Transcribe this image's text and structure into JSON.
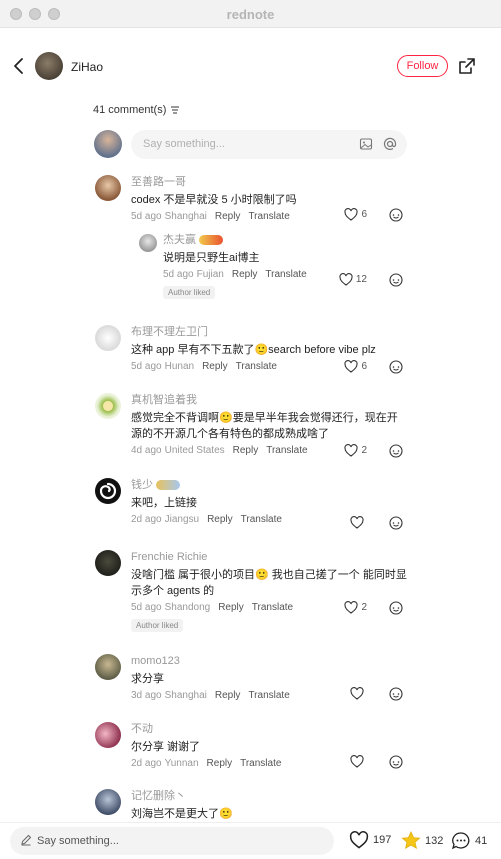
{
  "window": {
    "title": "rednote"
  },
  "header": {
    "author_name": "ZiHao",
    "follow_label": "Follow"
  },
  "comments_header": {
    "count_label": "41 comment(s)",
    "input_placeholder": "Say something..."
  },
  "comments": [
    {
      "name": "至善路一哥",
      "text": "codex 不是早就没 5 小时限制了吗",
      "time": "5d ago",
      "location": "Shanghai",
      "reply": "Reply",
      "translate": "Translate",
      "likes": "6"
    },
    {
      "name": "杰夫赢",
      "text": "说明是只野生ai博主",
      "time": "5d ago",
      "location": "Fujian",
      "reply": "Reply",
      "translate": "Translate",
      "likes": "12",
      "tag": "Author liked"
    },
    {
      "name": "布理不理左卫门",
      "text": "这种 app 早有不下五款了🙂search before vibe plz",
      "time": "5d ago",
      "location": "Hunan",
      "reply": "Reply",
      "translate": "Translate",
      "likes": "6"
    },
    {
      "name": "真机智追着我",
      "text": "感觉完全不背调啊🙂要是早半年我会觉得还行，现在开源的不开源几个各有特色的都成熟成啥了",
      "time": "4d ago",
      "location": "United States",
      "reply": "Reply",
      "translate": "Translate",
      "likes": "2"
    },
    {
      "name": "钱少",
      "text": "来吧，上链接",
      "time": "2d ago",
      "location": "Jiangsu",
      "reply": "Reply",
      "translate": "Translate",
      "likes": ""
    },
    {
      "name": "Frenchie Richie",
      "text": "没啥门槛 属于很小的项目🙂 我也自己搓了一个 能同时显示多个 agents 的",
      "time": "5d ago",
      "location": "Shandong",
      "reply": "Reply",
      "translate": "Translate",
      "likes": "2",
      "tag": "Author liked"
    },
    {
      "name": "momo123",
      "text": "求分享",
      "time": "3d ago",
      "location": "Shanghai",
      "reply": "Reply",
      "translate": "Translate",
      "likes": ""
    },
    {
      "name": "不动",
      "text": "尔分享 谢谢了",
      "time": "2d ago",
      "location": "Yunnan",
      "reply": "Reply",
      "translate": "Translate",
      "likes": ""
    },
    {
      "name": "记忆删除丶",
      "text": "刘海岂不是更大了🙂"
    }
  ],
  "bottom_bar": {
    "placeholder": "Say something...",
    "likes": "197",
    "collects": "132",
    "comments": "41"
  },
  "colors": {
    "accent": "#ff2442",
    "star": "#f5c518"
  }
}
